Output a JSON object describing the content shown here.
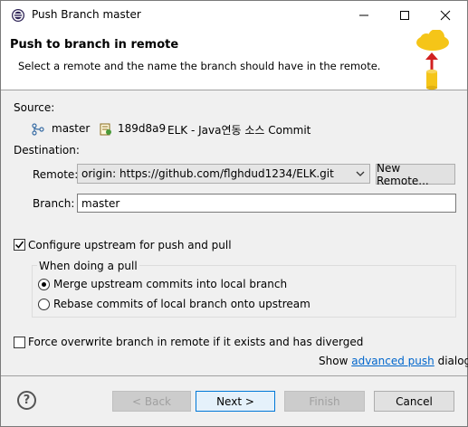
{
  "window": {
    "title": "Push Branch master"
  },
  "header": {
    "title": "Push to branch in remote",
    "description": "Select a remote and the name the branch should have in the remote."
  },
  "source": {
    "label": "Source:",
    "branch": "master",
    "commit_id": "189d8a9",
    "commit_message": "ELK - Java연동 소스 Commit"
  },
  "destination": {
    "label": "Destination:",
    "remote_label": "Remote:",
    "remote_value": "origin: https://github.com/flghdud1234/ELK.git",
    "new_remote_button": "New Remote...",
    "branch_label": "Branch:",
    "branch_value": "master"
  },
  "options": {
    "configure_upstream": "Configure upstream for push and pull",
    "configure_upstream_checked": true,
    "when_doing_pull": "When doing a pull",
    "merge_option": "Merge upstream commits into local branch",
    "rebase_option": "Rebase commits of local branch onto upstream",
    "selected": "merge",
    "force_overwrite": "Force overwrite branch in remote if it exists and has diverged",
    "force_overwrite_checked": false
  },
  "advanced": {
    "prefix": "Show",
    "link": "advanced push",
    "suffix": "dialog"
  },
  "footer": {
    "back": "< Back",
    "next": "Next >",
    "finish": "Finish",
    "cancel": "Cancel",
    "help_glyph": "?"
  },
  "icons": {
    "app": "eclipse-icon",
    "branch": "branch-icon",
    "commit": "commit-icon",
    "header": "cloud-push-icon",
    "help": "help-icon"
  },
  "colors": {
    "accent": "#0078d7",
    "link": "#0066cc",
    "cloud": "#f5c518"
  }
}
